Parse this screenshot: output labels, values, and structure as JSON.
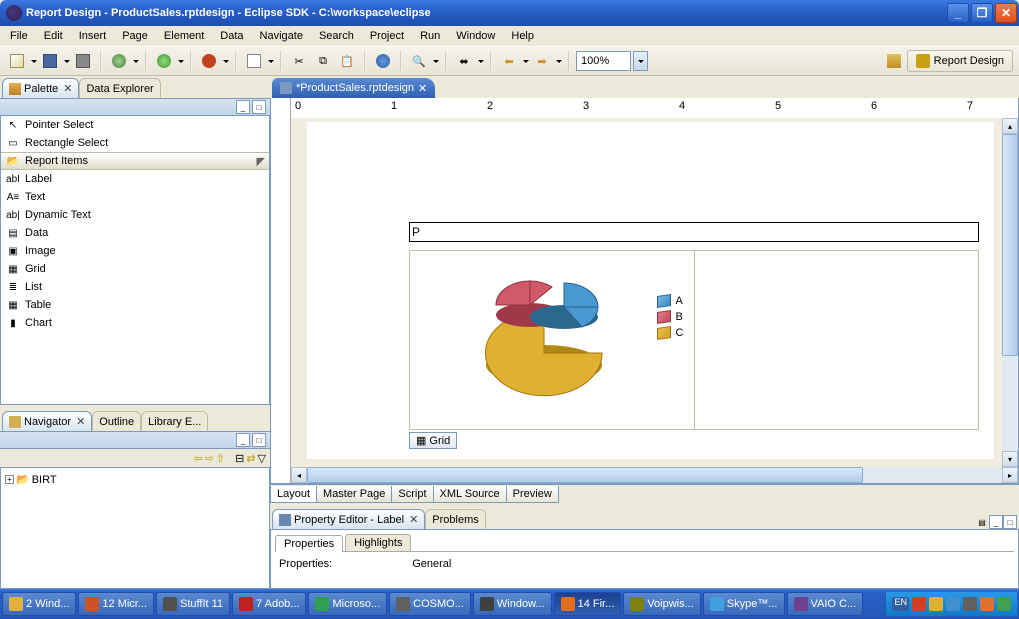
{
  "window": {
    "title": "Report Design - ProductSales.rptdesign - Eclipse SDK - C:\\workspace\\eclipse"
  },
  "menu": {
    "items": [
      "File",
      "Edit",
      "Insert",
      "Page",
      "Element",
      "Data",
      "Navigate",
      "Search",
      "Project",
      "Run",
      "Window",
      "Help"
    ]
  },
  "toolbar": {
    "zoom": "100%",
    "perspective_label": "Report Design"
  },
  "palette": {
    "tab_palette": "Palette",
    "tab_data_explorer": "Data Explorer",
    "items": [
      {
        "label": "Pointer Select",
        "icon": "↖",
        "bg": "#fff"
      },
      {
        "label": "Rectangle Select",
        "icon": "▭",
        "bg": "#fff"
      }
    ],
    "section": "Report Items",
    "report_items": [
      {
        "label": "Label",
        "icon": "abI",
        "color": "#4060a0"
      },
      {
        "label": "Text",
        "icon": "A≡",
        "color": "#4060a0"
      },
      {
        "label": "Dynamic Text",
        "icon": "ab|",
        "color": "#000"
      },
      {
        "label": "Data",
        "icon": "▤",
        "color": "#4060a0"
      },
      {
        "label": "Image",
        "icon": "▣",
        "color": "#60a060"
      },
      {
        "label": "Grid",
        "icon": "▦",
        "color": "#888"
      },
      {
        "label": "List",
        "icon": "≣",
        "color": "#4060a0"
      },
      {
        "label": "Table",
        "icon": "▦",
        "color": "#c09030"
      },
      {
        "label": "Chart",
        "icon": "▮",
        "color": "#e0a020"
      }
    ]
  },
  "navigator": {
    "tab_navigator": "Navigator",
    "tab_outline": "Outline",
    "tab_library": "Library E...",
    "tree_root": "BIRT"
  },
  "editor": {
    "tab_title": "*ProductSales.rptdesign",
    "cell_input": "P",
    "grid_tag": "Grid",
    "bottom_tabs": [
      "Layout",
      "Master Page",
      "Script",
      "XML Source",
      "Preview"
    ],
    "ruler": [
      "0",
      "1",
      "2",
      "3",
      "4",
      "5",
      "6",
      "7"
    ]
  },
  "chart_data": {
    "type": "pie",
    "title": "",
    "series": [
      {
        "name": "A",
        "value": 25,
        "color": "#4a98d0"
      },
      {
        "name": "B",
        "value": 20,
        "color": "#d05a68"
      },
      {
        "name": "C",
        "value": 55,
        "color": "#e0b030"
      }
    ],
    "style": "3d-exploded",
    "legend_position": "right"
  },
  "property_editor": {
    "title": "Property Editor - Label",
    "tab_problems": "Problems",
    "subtabs": [
      "Properties",
      "Highlights"
    ],
    "row_label": "Properties:",
    "row_value": "General"
  },
  "taskbar": {
    "items": [
      {
        "label": "2 Wind...",
        "icon_bg": "#e0b040"
      },
      {
        "label": "12 Micr...",
        "icon_bg": "#d05028"
      },
      {
        "label": "StuffIt 11",
        "icon_bg": "#505050"
      },
      {
        "label": "7 Adob...",
        "icon_bg": "#c02020"
      },
      {
        "label": "Microso...",
        "icon_bg": "#30a050"
      },
      {
        "label": "COSMO...",
        "icon_bg": "#606060"
      },
      {
        "label": "Window...",
        "icon_bg": "#404040"
      },
      {
        "label": "14 Fir...",
        "icon_bg": "#e07020",
        "active": true
      },
      {
        "label": "Voipwis...",
        "icon_bg": "#808010"
      },
      {
        "label": "Skype™...",
        "icon_bg": "#40a0e0"
      },
      {
        "label": "VAIO C...",
        "icon_bg": "#704090"
      }
    ],
    "tray_lang": "EN"
  }
}
